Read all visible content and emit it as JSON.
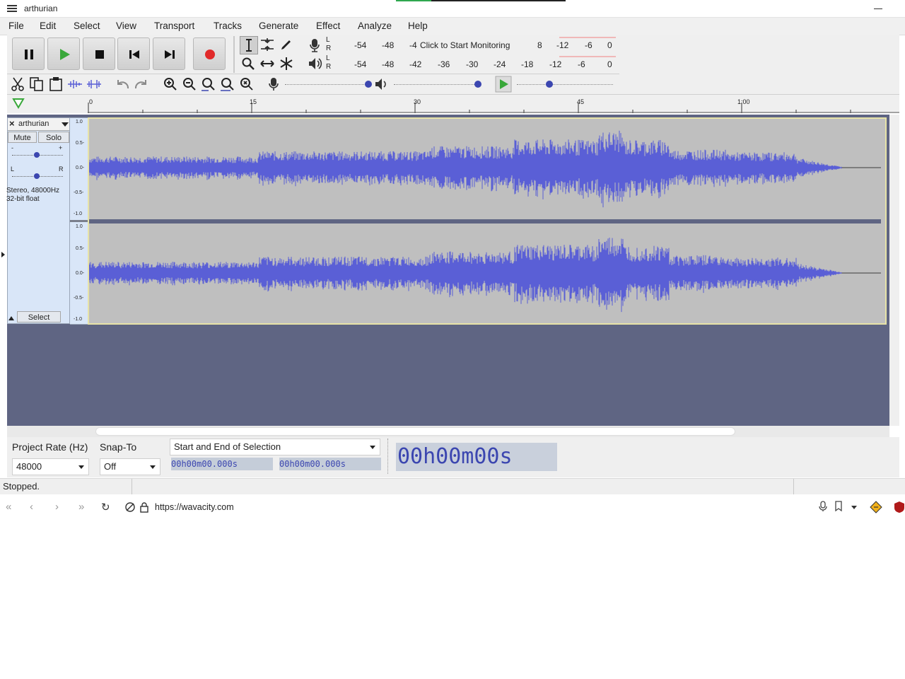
{
  "window": {
    "title": "arthurian"
  },
  "menu": [
    "File",
    "Edit",
    "Select",
    "View",
    "Transport",
    "Tracks",
    "Generate",
    "Effect",
    "Analyze",
    "Help"
  ],
  "meters": {
    "record_ticks": [
      "-54",
      "-48",
      "-4",
      "8",
      "-12",
      "-6",
      "0"
    ],
    "monitor_prompt": "Click to Start Monitoring",
    "playback_ticks": [
      "-54",
      "-48",
      "-42",
      "-36",
      "-30",
      "-24",
      "-18",
      "-12",
      "-6",
      "0"
    ],
    "channel_labels": [
      "L",
      "R"
    ]
  },
  "ruler": {
    "labels": [
      "0",
      "15",
      "30",
      "45",
      "1:00"
    ]
  },
  "track": {
    "name": "arthurian",
    "mute_label": "Mute",
    "solo_label": "Solo",
    "gain_minus": "-",
    "gain_plus": "+",
    "pan_left": "L",
    "pan_right": "R",
    "info_line1": "Stereo, 48000Hz",
    "info_line2": "32-bit float",
    "select_label": "Select",
    "scale_top": [
      "1.0",
      "0.5-",
      "0.0-",
      "-0.5-",
      "-1.0"
    ],
    "scale_bottom": [
      "1.0",
      "0.5-",
      "0.0-",
      "-0.5-",
      "-1.0"
    ],
    "wave_color": "#5a5fd6"
  },
  "bottom": {
    "project_rate_label": "Project Rate (Hz)",
    "project_rate_value": "48000",
    "snap_label": "Snap-To",
    "snap_value": "Off",
    "selection_mode": "Start and End of Selection",
    "sel_start": "00h00m00.000s",
    "sel_end": "00h00m00.000s",
    "audio_position": "00h00m00s"
  },
  "status": {
    "text": "Stopped."
  },
  "browser": {
    "url": "https://wavacity.com"
  }
}
